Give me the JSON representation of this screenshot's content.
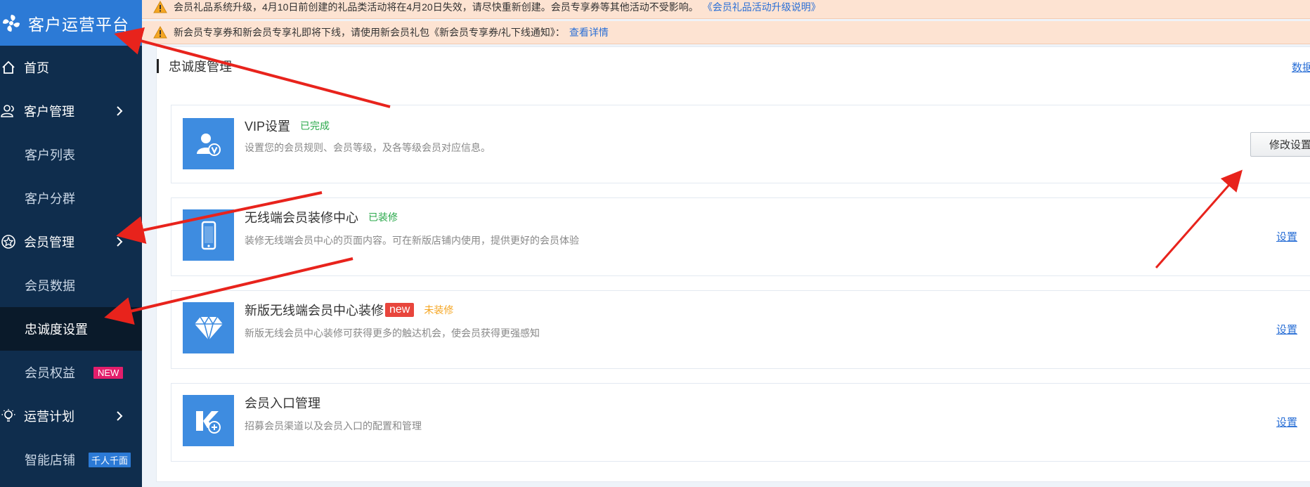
{
  "app": {
    "title": "客户运营平台"
  },
  "sidebar": {
    "items": [
      {
        "label": "首页",
        "type": "top"
      },
      {
        "label": "客户管理",
        "type": "top"
      },
      {
        "label": "客户列表",
        "type": "sub"
      },
      {
        "label": "客户分群",
        "type": "sub"
      },
      {
        "label": "会员管理",
        "type": "top"
      },
      {
        "label": "会员数据",
        "type": "sub"
      },
      {
        "label": "忠诚度设置",
        "type": "sub",
        "active": true
      },
      {
        "label": "会员权益",
        "type": "sub",
        "badge": "NEW"
      },
      {
        "label": "运营计划",
        "type": "top"
      },
      {
        "label": "智能店铺",
        "type": "sub",
        "badge": "千人千面"
      }
    ]
  },
  "notices": [
    {
      "text": "会员礼品系统升级，4月10日前创建的礼品类活动将在4月20日失效，请尽快重新创建。会员专享券等其他活动不受影响。",
      "link": "《会员礼品活动升级说明》"
    },
    {
      "text": "新会员专享券和新会员专享礼即将下线，请使用新会员礼包《新会员专享券/礼下线通知》：",
      "link": "查看详情"
    }
  ],
  "panel": {
    "title": "忠诚度管理",
    "data_link": "数据设"
  },
  "cards": [
    {
      "title": "VIP设置",
      "status": "已完成",
      "desc": "设置您的会员规则、会员等级，及各等级会员对应信息。",
      "action": "修改设置"
    },
    {
      "title": "无线端会员装修中心",
      "status": "已装修",
      "desc": "装修无线端会员中心的页面内容。可在新版店铺内使用，提供更好的会员体验",
      "action": "设置"
    },
    {
      "title": "新版无线端会员中心装修",
      "tag": "new",
      "status": "未装修",
      "desc": "新版无线会员中心装修可获得更多的触达机会，使会员获得更强感知",
      "action": "设置"
    },
    {
      "title": "会员入口管理",
      "desc": "招募会员渠道以及会员入口的配置和管理",
      "action": "设置"
    }
  ],
  "colors": {
    "sidebar": "#0f2d4d",
    "brand": "#2c7ad6",
    "accent": "#2a6fd6",
    "annotation": "#e8231c"
  }
}
